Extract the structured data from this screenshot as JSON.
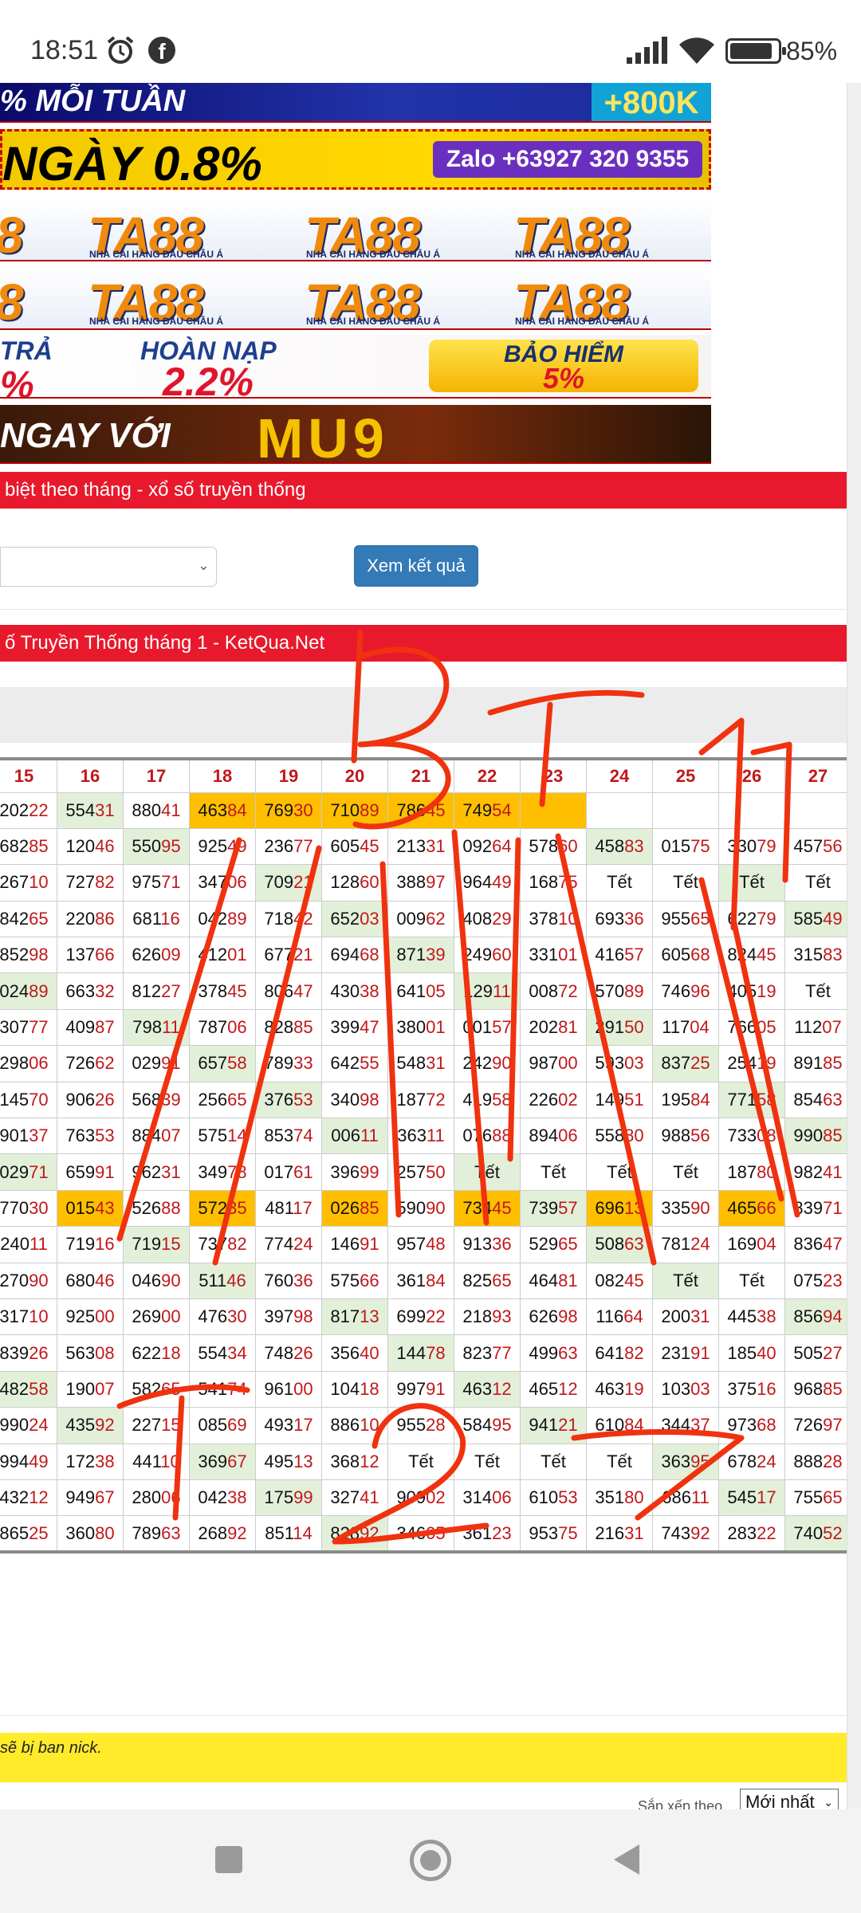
{
  "status_bar": {
    "time": "18:51",
    "battery": "85%",
    "battery_level": 0.85,
    "icons": [
      "alarm-icon",
      "facebook-icon",
      "signal-icon",
      "wifi-icon",
      "battery-icon"
    ]
  },
  "banners": {
    "b1_text": "% MỖI TUẦN",
    "b1_bonus": "+800K",
    "b2_text": "NGÀY 0.8%",
    "b2_contact": "Zalo +63927 320 9355",
    "ta88": [
      "8",
      "TA88",
      "TA88",
      "TA88"
    ],
    "ta88_tagline": "NHÀ CÁI HÀNG ĐẦU CHÂU Á",
    "b5_left_top": "TRẢ",
    "b5_left_bottom": "%",
    "b5_mid_top": "HOÀN NẠP",
    "b5_mid_bottom": "2.2%",
    "b5_right_top": "BẢO HIỂM",
    "b5_right_bottom": "5%",
    "b6_text": "NGAY VỚI",
    "b6_brand": "MU9"
  },
  "section1_title": "biệt theo tháng - xổ số truyền thống",
  "view_button": "Xem kết quả",
  "section2_title": "ố Truyền Thống tháng 1 - KetQua.Net",
  "table": {
    "headers": [
      "15",
      "16",
      "17",
      "18",
      "19",
      "20",
      "21",
      "22",
      "23",
      "24",
      "25",
      "26",
      "27"
    ],
    "rows": [
      [
        [
          "20222",
          ""
        ],
        [
          "55431",
          "g"
        ],
        [
          "88041",
          ""
        ],
        [
          "46384",
          "y"
        ],
        [
          "76930",
          "y"
        ],
        [
          "71089",
          "y"
        ],
        [
          "78645",
          "y"
        ],
        [
          "74954",
          "y"
        ],
        [
          "",
          "y"
        ],
        [
          "",
          ""
        ],
        [
          "",
          ""
        ],
        [
          "",
          ""
        ],
        [
          "",
          ""
        ]
      ],
      [
        [
          "68285",
          ""
        ],
        [
          "12046",
          ""
        ],
        [
          "55095",
          "g"
        ],
        [
          "92549",
          ""
        ],
        [
          "23677",
          ""
        ],
        [
          "60545",
          ""
        ],
        [
          "21331",
          ""
        ],
        [
          "09264",
          ""
        ],
        [
          "57860",
          ""
        ],
        [
          "45883",
          "g"
        ],
        [
          "01575",
          ""
        ],
        [
          "33079",
          ""
        ],
        [
          "45756",
          ""
        ]
      ],
      [
        [
          "26710",
          ""
        ],
        [
          "72782",
          ""
        ],
        [
          "97571",
          ""
        ],
        [
          "34706",
          ""
        ],
        [
          "70921",
          "g"
        ],
        [
          "12860",
          ""
        ],
        [
          "38897",
          ""
        ],
        [
          "96449",
          ""
        ],
        [
          "16875",
          ""
        ],
        [
          "Tết",
          ""
        ],
        [
          "Tết",
          ""
        ],
        [
          "Tết",
          "g"
        ],
        [
          "Tết",
          ""
        ]
      ],
      [
        [
          "84265",
          ""
        ],
        [
          "22086",
          ""
        ],
        [
          "68116",
          ""
        ],
        [
          "04289",
          ""
        ],
        [
          "71842",
          ""
        ],
        [
          "65203",
          "g"
        ],
        [
          "00962",
          ""
        ],
        [
          "40829",
          ""
        ],
        [
          "37810",
          ""
        ],
        [
          "69336",
          ""
        ],
        [
          "95565",
          ""
        ],
        [
          "62279",
          ""
        ],
        [
          "58549",
          "g"
        ]
      ],
      [
        [
          "85298",
          ""
        ],
        [
          "13766",
          ""
        ],
        [
          "62609",
          ""
        ],
        [
          "41201",
          ""
        ],
        [
          "67721",
          ""
        ],
        [
          "69468",
          ""
        ],
        [
          "87139",
          "g"
        ],
        [
          "24960",
          ""
        ],
        [
          "33101",
          ""
        ],
        [
          "41657",
          ""
        ],
        [
          "60568",
          ""
        ],
        [
          "82445",
          ""
        ],
        [
          "31583",
          ""
        ]
      ],
      [
        [
          "02489",
          "g"
        ],
        [
          "66332",
          ""
        ],
        [
          "81227",
          ""
        ],
        [
          "37845",
          ""
        ],
        [
          "80647",
          ""
        ],
        [
          "43038",
          ""
        ],
        [
          "64105",
          ""
        ],
        [
          "12911",
          "g"
        ],
        [
          "00872",
          ""
        ],
        [
          "57089",
          ""
        ],
        [
          "74696",
          ""
        ],
        [
          "40519",
          ""
        ],
        [
          "Tết",
          ""
        ]
      ],
      [
        [
          "30777",
          ""
        ],
        [
          "40987",
          ""
        ],
        [
          "79811",
          "g"
        ],
        [
          "78706",
          ""
        ],
        [
          "82885",
          ""
        ],
        [
          "39947",
          ""
        ],
        [
          "38001",
          ""
        ],
        [
          "00157",
          ""
        ],
        [
          "20281",
          ""
        ],
        [
          "29150",
          "g"
        ],
        [
          "11704",
          ""
        ],
        [
          "76605",
          ""
        ],
        [
          "11207",
          ""
        ]
      ],
      [
        [
          "29806",
          ""
        ],
        [
          "72662",
          ""
        ],
        [
          "02991",
          ""
        ],
        [
          "65758",
          "g"
        ],
        [
          "78933",
          ""
        ],
        [
          "64255",
          ""
        ],
        [
          "54831",
          ""
        ],
        [
          "24290",
          ""
        ],
        [
          "98700",
          ""
        ],
        [
          "59303",
          ""
        ],
        [
          "83725",
          "g"
        ],
        [
          "25419",
          ""
        ],
        [
          "89185",
          ""
        ]
      ],
      [
        [
          "14570",
          ""
        ],
        [
          "90626",
          ""
        ],
        [
          "56839",
          ""
        ],
        [
          "25665",
          ""
        ],
        [
          "37653",
          "g"
        ],
        [
          "34098",
          ""
        ],
        [
          "18772",
          ""
        ],
        [
          "41958",
          ""
        ],
        [
          "22602",
          ""
        ],
        [
          "14951",
          ""
        ],
        [
          "19584",
          ""
        ],
        [
          "77158",
          "g"
        ],
        [
          "85463",
          ""
        ]
      ],
      [
        [
          "90137",
          ""
        ],
        [
          "76353",
          ""
        ],
        [
          "88407",
          ""
        ],
        [
          "57514",
          ""
        ],
        [
          "85374",
          ""
        ],
        [
          "00611",
          "g"
        ],
        [
          "36311",
          ""
        ],
        [
          "07688",
          ""
        ],
        [
          "89406",
          ""
        ],
        [
          "55880",
          ""
        ],
        [
          "98856",
          ""
        ],
        [
          "73308",
          ""
        ],
        [
          "99085",
          "g"
        ]
      ],
      [
        [
          "02971",
          "g"
        ],
        [
          "65991",
          ""
        ],
        [
          "96231",
          ""
        ],
        [
          "34978",
          ""
        ],
        [
          "01761",
          ""
        ],
        [
          "39699",
          ""
        ],
        [
          "25750",
          ""
        ],
        [
          "Tết",
          "g"
        ],
        [
          "Tết",
          ""
        ],
        [
          "Tết",
          ""
        ],
        [
          "Tết",
          ""
        ],
        [
          "18780",
          ""
        ],
        [
          "98241",
          ""
        ]
      ],
      [
        [
          "77030",
          ""
        ],
        [
          "01543",
          "y"
        ],
        [
          "52688",
          ""
        ],
        [
          "57235",
          "y"
        ],
        [
          "48117",
          ""
        ],
        [
          "02685",
          "y"
        ],
        [
          "59090",
          ""
        ],
        [
          "73445",
          "y"
        ],
        [
          "73957",
          "g"
        ],
        [
          "69613",
          "y"
        ],
        [
          "33590",
          ""
        ],
        [
          "46566",
          "y"
        ],
        [
          "83971",
          ""
        ]
      ],
      [
        [
          "24011",
          ""
        ],
        [
          "71916",
          ""
        ],
        [
          "71915",
          "g"
        ],
        [
          "73782",
          ""
        ],
        [
          "77424",
          ""
        ],
        [
          "14691",
          ""
        ],
        [
          "95748",
          ""
        ],
        [
          "91336",
          ""
        ],
        [
          "52965",
          ""
        ],
        [
          "50863",
          "g"
        ],
        [
          "78124",
          ""
        ],
        [
          "16904",
          ""
        ],
        [
          "83647",
          ""
        ]
      ],
      [
        [
          "27090",
          ""
        ],
        [
          "68046",
          ""
        ],
        [
          "04690",
          ""
        ],
        [
          "51146",
          "g"
        ],
        [
          "76036",
          ""
        ],
        [
          "57566",
          ""
        ],
        [
          "36184",
          ""
        ],
        [
          "82565",
          ""
        ],
        [
          "46481",
          ""
        ],
        [
          "08245",
          ""
        ],
        [
          "Tết",
          "g"
        ],
        [
          "Tết",
          ""
        ],
        [
          "07523",
          ""
        ]
      ],
      [
        [
          "31710",
          ""
        ],
        [
          "92500",
          ""
        ],
        [
          "26900",
          ""
        ],
        [
          "47630",
          ""
        ],
        [
          "39798",
          ""
        ],
        [
          "81713",
          "g"
        ],
        [
          "69922",
          ""
        ],
        [
          "21893",
          ""
        ],
        [
          "62698",
          ""
        ],
        [
          "11664",
          ""
        ],
        [
          "20031",
          ""
        ],
        [
          "44538",
          ""
        ],
        [
          "85694",
          "g"
        ]
      ],
      [
        [
          "83926",
          ""
        ],
        [
          "56308",
          ""
        ],
        [
          "62218",
          ""
        ],
        [
          "55434",
          ""
        ],
        [
          "74826",
          ""
        ],
        [
          "35640",
          ""
        ],
        [
          "14478",
          "g"
        ],
        [
          "82377",
          ""
        ],
        [
          "49963",
          ""
        ],
        [
          "64182",
          ""
        ],
        [
          "23191",
          ""
        ],
        [
          "18540",
          ""
        ],
        [
          "50527",
          ""
        ]
      ],
      [
        [
          "48258",
          "g"
        ],
        [
          "19007",
          ""
        ],
        [
          "58265",
          ""
        ],
        [
          "54174",
          ""
        ],
        [
          "96100",
          ""
        ],
        [
          "10418",
          ""
        ],
        [
          "99791",
          ""
        ],
        [
          "46312",
          "g"
        ],
        [
          "46512",
          ""
        ],
        [
          "46319",
          ""
        ],
        [
          "10303",
          ""
        ],
        [
          "37516",
          ""
        ],
        [
          "96885",
          ""
        ]
      ],
      [
        [
          "99024",
          ""
        ],
        [
          "43592",
          "g"
        ],
        [
          "22715",
          ""
        ],
        [
          "08569",
          ""
        ],
        [
          "49317",
          ""
        ],
        [
          "88610",
          ""
        ],
        [
          "95528",
          ""
        ],
        [
          "58495",
          ""
        ],
        [
          "94121",
          "g"
        ],
        [
          "61084",
          ""
        ],
        [
          "34437",
          ""
        ],
        [
          "97368",
          ""
        ],
        [
          "72697",
          ""
        ]
      ],
      [
        [
          "99449",
          ""
        ],
        [
          "17238",
          ""
        ],
        [
          "44110",
          ""
        ],
        [
          "36967",
          "g"
        ],
        [
          "49513",
          ""
        ],
        [
          "36812",
          ""
        ],
        [
          "Tết",
          ""
        ],
        [
          "Tết",
          ""
        ],
        [
          "Tết",
          ""
        ],
        [
          "Tết",
          ""
        ],
        [
          "36395",
          "g"
        ],
        [
          "67824",
          ""
        ],
        [
          "88828",
          ""
        ]
      ],
      [
        [
          "43212",
          ""
        ],
        [
          "94967",
          ""
        ],
        [
          "28006",
          ""
        ],
        [
          "04238",
          ""
        ],
        [
          "17599",
          "g"
        ],
        [
          "32741",
          ""
        ],
        [
          "90902",
          ""
        ],
        [
          "31406",
          ""
        ],
        [
          "61053",
          ""
        ],
        [
          "35180",
          ""
        ],
        [
          "68611",
          ""
        ],
        [
          "54517",
          "g"
        ],
        [
          "75565",
          ""
        ]
      ],
      [
        [
          "86525",
          ""
        ],
        [
          "36080",
          ""
        ],
        [
          "78963",
          ""
        ],
        [
          "26892",
          ""
        ],
        [
          "85114",
          ""
        ],
        [
          "82892",
          "g"
        ],
        [
          "34605",
          ""
        ],
        [
          "36123",
          ""
        ],
        [
          "95375",
          ""
        ],
        [
          "21631",
          ""
        ],
        [
          "74392",
          ""
        ],
        [
          "28322",
          ""
        ],
        [
          "74052",
          "g"
        ]
      ]
    ]
  },
  "warning_text": "sẽ bị ban nick.",
  "sort_label": "Sắp xếp theo",
  "sort_value": "Mới nhất",
  "colors": {
    "red_bar": "#e8192c",
    "highlight_yellow": "#ffbf00",
    "highlight_green": "#e2f0d9",
    "button_blue": "#337ab7",
    "digit_red": "#c0181b",
    "scribble": "#f0320f",
    "warn_bg": "#ffeb2a"
  },
  "handwriting": [
    "B",
    "T",
    "11",
    "T",
    "27"
  ]
}
